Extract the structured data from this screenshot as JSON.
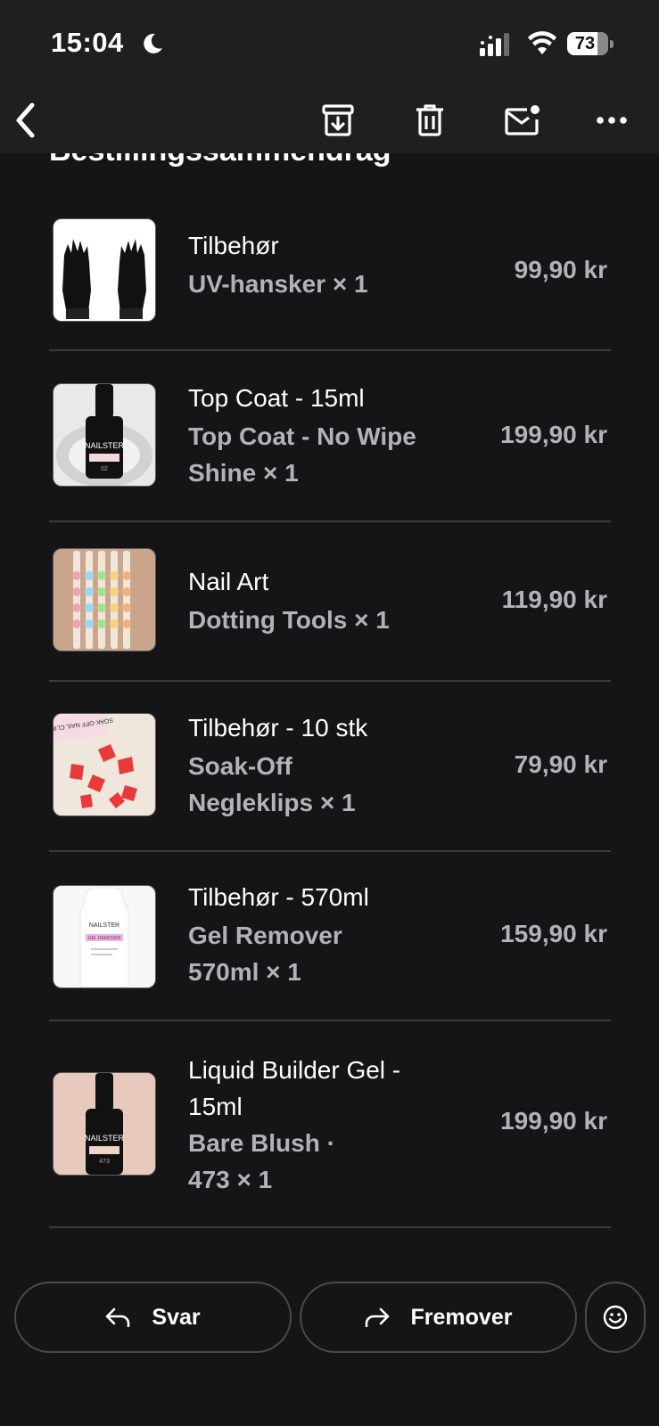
{
  "status": {
    "time": "15:04",
    "battery": "73"
  },
  "section": {
    "title": "Bestillingssammendrag"
  },
  "items": [
    {
      "title": "Tilbehør",
      "sub": "UV-hansker × 1",
      "price": "99,90 kr"
    },
    {
      "title": "Top Coat - 15ml",
      "sub": "Top Coat - No Wipe Shine × 1",
      "price": "199,90 kr"
    },
    {
      "title": "Nail Art",
      "sub": "Dotting Tools × 1",
      "price": "119,90 kr"
    },
    {
      "title": "Tilbehør - 10 stk",
      "sub": "Soak-Off Negleklips × 1",
      "price": "79,90 kr"
    },
    {
      "title": "Tilbehør - 570ml",
      "sub": "Gel Remover 570ml × 1",
      "price": "159,90 kr"
    },
    {
      "title": "Liquid Builder Gel - 15ml",
      "sub": "Bare Blush · 473 × 1",
      "price": "199,90 kr"
    }
  ],
  "thumb_text": {
    "brand": "NAILSTER",
    "topcoat_num": "02",
    "builder_num": "473",
    "gel_remover": "GEL REMOVER",
    "soak_off": "SOAK-OFF NAIL CLIPS"
  },
  "actions": {
    "reply": "Svar",
    "forward": "Fremover"
  }
}
